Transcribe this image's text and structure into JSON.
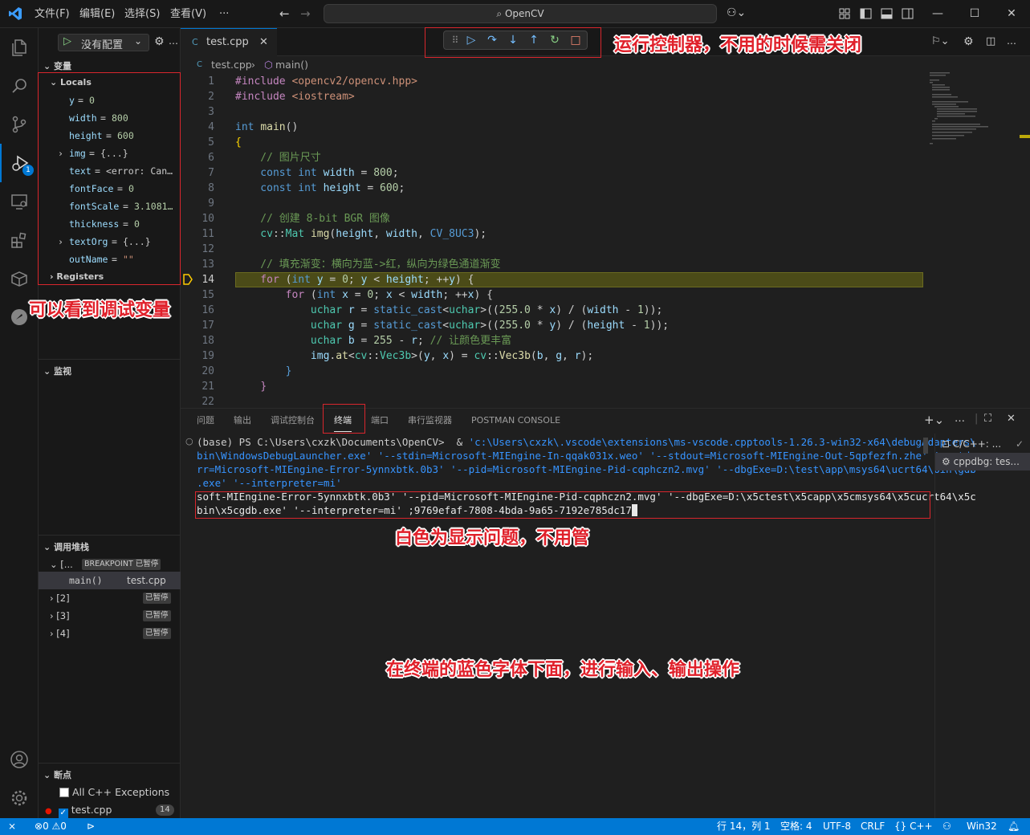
{
  "titlebar": {
    "menu": [
      "文件(F)",
      "编辑(E)",
      "选择(S)",
      "查看(V)",
      "···"
    ],
    "command_center": "OpenCV"
  },
  "sidebar": {
    "debug_config": "没有配置",
    "variables_header": "变量",
    "locals_header": "Locals",
    "locals": [
      {
        "name": "y",
        "value": "0",
        "kind": "num"
      },
      {
        "name": "width",
        "value": "800",
        "kind": "num"
      },
      {
        "name": "height",
        "value": "600",
        "kind": "num"
      },
      {
        "name": "img",
        "value": "{...}",
        "kind": "obj",
        "expandable": true
      },
      {
        "name": "text",
        "value": "<error: Can…",
        "kind": "obj"
      },
      {
        "name": "fontFace",
        "value": "0",
        "kind": "num"
      },
      {
        "name": "fontScale",
        "value": "3.1081…",
        "kind": "num"
      },
      {
        "name": "thickness",
        "value": "0",
        "kind": "num"
      },
      {
        "name": "textOrg",
        "value": "{...}",
        "kind": "obj",
        "expandable": true
      },
      {
        "name": "outName",
        "value": "\"\"",
        "kind": "str"
      }
    ],
    "registers_header": "Registers",
    "watch_header": "监视",
    "callstack_header": "调用堆栈",
    "callstack": {
      "thread_label": "[...",
      "thread_badge": "BREAKPOINT 已暂停",
      "frame_fn": "main()",
      "frame_file": "test.cpp",
      "threads": [
        {
          "label": "[2]",
          "badge": "已暂停"
        },
        {
          "label": "[3]",
          "badge": "已暂停"
        },
        {
          "label": "[4]",
          "badge": "已暂停"
        }
      ]
    },
    "breakpoints_header": "断点",
    "breakpoints": [
      {
        "label": "All C++ Exceptions",
        "checked": false
      },
      {
        "label": "test.cpp",
        "checked": true,
        "count": "14"
      }
    ]
  },
  "editor": {
    "tab": "test.cpp",
    "breadcrumb": [
      "test.cpp",
      "main()"
    ],
    "current_line": "14",
    "lines": [
      {
        "n": "1",
        "tokens": [
          [
            "pp",
            "#include "
          ],
          [
            "s",
            "<opencv2/opencv.hpp>"
          ]
        ]
      },
      {
        "n": "2",
        "tokens": [
          [
            "pp",
            "#include "
          ],
          [
            "s",
            "<iostream>"
          ]
        ]
      },
      {
        "n": "3",
        "tokens": []
      },
      {
        "n": "4",
        "tokens": [
          [
            "k",
            "int "
          ],
          [
            "f",
            "main"
          ],
          [
            "p",
            "()"
          ]
        ]
      },
      {
        "n": "5",
        "tokens": [
          [
            "br",
            "{"
          ]
        ]
      },
      {
        "n": "6",
        "tokens": [
          [
            "c",
            "    // 图片尺寸"
          ]
        ]
      },
      {
        "n": "7",
        "tokens": [
          [
            "k",
            "    const int "
          ],
          [
            "v",
            "width"
          ],
          [
            "p",
            " = "
          ],
          [
            "n",
            "800"
          ],
          [
            "p",
            ";"
          ]
        ]
      },
      {
        "n": "8",
        "tokens": [
          [
            "k",
            "    const int "
          ],
          [
            "v",
            "height"
          ],
          [
            "p",
            " = "
          ],
          [
            "n",
            "600"
          ],
          [
            "p",
            ";"
          ]
        ]
      },
      {
        "n": "9",
        "tokens": []
      },
      {
        "n": "10",
        "tokens": [
          [
            "c",
            "    // 创建 8-bit BGR 图像"
          ]
        ]
      },
      {
        "n": "11",
        "tokens": [
          [
            "t",
            "    cv"
          ],
          [
            "p",
            "::"
          ],
          [
            "t",
            "Mat "
          ],
          [
            "f",
            "img"
          ],
          [
            "p",
            "("
          ],
          [
            "v",
            "height"
          ],
          [
            "p",
            ", "
          ],
          [
            "v",
            "width"
          ],
          [
            "p",
            ", "
          ],
          [
            "k",
            "CV_8UC3"
          ],
          [
            "p",
            ");"
          ]
        ]
      },
      {
        "n": "12",
        "tokens": []
      },
      {
        "n": "13",
        "tokens": [
          [
            "c",
            "    // 填充渐变：横向为蓝->红，纵向为绿色通道渐变"
          ]
        ]
      },
      {
        "n": "14",
        "tokens": [
          [
            "pp",
            "    for "
          ],
          [
            "p",
            "("
          ],
          [
            "k",
            "int "
          ],
          [
            "v",
            "y"
          ],
          [
            "p",
            " = "
          ],
          [
            "n",
            "0"
          ],
          [
            "p",
            "; "
          ],
          [
            "v",
            "y"
          ],
          [
            "p",
            " < "
          ],
          [
            "v",
            "height"
          ],
          [
            "p",
            "; ++"
          ],
          [
            "v",
            "y"
          ],
          [
            "p",
            ") {"
          ]
        ]
      },
      {
        "n": "15",
        "tokens": [
          [
            "pp",
            "        for "
          ],
          [
            "p",
            "("
          ],
          [
            "k",
            "int "
          ],
          [
            "v",
            "x"
          ],
          [
            "p",
            " = "
          ],
          [
            "n",
            "0"
          ],
          [
            "p",
            "; "
          ],
          [
            "v",
            "x"
          ],
          [
            "p",
            " < "
          ],
          [
            "v",
            "width"
          ],
          [
            "p",
            "; ++"
          ],
          [
            "v",
            "x"
          ],
          [
            "p",
            ") {"
          ]
        ]
      },
      {
        "n": "16",
        "tokens": [
          [
            "t",
            "            uchar "
          ],
          [
            "v",
            "r"
          ],
          [
            "p",
            " = "
          ],
          [
            "k",
            "static_cast"
          ],
          [
            "p",
            "<"
          ],
          [
            "t",
            "uchar"
          ],
          [
            "p",
            ">(("
          ],
          [
            "n",
            "255.0"
          ],
          [
            "p",
            " * "
          ],
          [
            "v",
            "x"
          ],
          [
            "p",
            ") / ("
          ],
          [
            "v",
            "width"
          ],
          [
            "p",
            " - "
          ],
          [
            "n",
            "1"
          ],
          [
            "p",
            "));"
          ]
        ]
      },
      {
        "n": "17",
        "tokens": [
          [
            "t",
            "            uchar "
          ],
          [
            "v",
            "g"
          ],
          [
            "p",
            " = "
          ],
          [
            "k",
            "static_cast"
          ],
          [
            "p",
            "<"
          ],
          [
            "t",
            "uchar"
          ],
          [
            "p",
            ">(("
          ],
          [
            "n",
            "255.0"
          ],
          [
            "p",
            " * "
          ],
          [
            "v",
            "y"
          ],
          [
            "p",
            ") / ("
          ],
          [
            "v",
            "height"
          ],
          [
            "p",
            " - "
          ],
          [
            "n",
            "1"
          ],
          [
            "p",
            "));"
          ]
        ]
      },
      {
        "n": "18",
        "tokens": [
          [
            "t",
            "            uchar "
          ],
          [
            "v",
            "b"
          ],
          [
            "p",
            " = "
          ],
          [
            "n",
            "255"
          ],
          [
            "p",
            " - "
          ],
          [
            "v",
            "r"
          ],
          [
            "p",
            "; "
          ],
          [
            "c",
            "// 让颜色更丰富"
          ]
        ]
      },
      {
        "n": "19",
        "tokens": [
          [
            "v",
            "            img"
          ],
          [
            "p",
            "."
          ],
          [
            "f",
            "at"
          ],
          [
            "p",
            "<"
          ],
          [
            "t",
            "cv"
          ],
          [
            "p",
            "::"
          ],
          [
            "t",
            "Vec3b"
          ],
          [
            "p",
            ">("
          ],
          [
            "v",
            "y"
          ],
          [
            "p",
            ", "
          ],
          [
            "v",
            "x"
          ],
          [
            "p",
            ") = "
          ],
          [
            "t",
            "cv"
          ],
          [
            "p",
            "::"
          ],
          [
            "f",
            "Vec3b"
          ],
          [
            "p",
            "("
          ],
          [
            "v",
            "b"
          ],
          [
            "p",
            ", "
          ],
          [
            "v",
            "g"
          ],
          [
            "p",
            ", "
          ],
          [
            "v",
            "r"
          ],
          [
            "p",
            ");"
          ]
        ]
      },
      {
        "n": "20",
        "tokens": [
          [
            "p",
            "        "
          ],
          [
            "k",
            "}"
          ]
        ]
      },
      {
        "n": "21",
        "tokens": [
          [
            "p",
            "    "
          ],
          [
            "pp",
            "}"
          ]
        ]
      },
      {
        "n": "22",
        "tokens": []
      }
    ]
  },
  "annotations": {
    "debug_toolbar": "运行控制器，不用的时候需关闭",
    "variables": "可以看到调试变量",
    "terminal_white": "白色为显示问题，不用管",
    "terminal_io": "在终端的蓝色字体下面，进行输入、输出操作"
  },
  "panel": {
    "tabs": [
      "问题",
      "输出",
      "调试控制台",
      "终端",
      "端口",
      "串行监视器",
      "POSTMAN CONSOLE"
    ],
    "active_tab": "终端",
    "terminal_prompt": "(base) PS C:\\Users\\cxzk\\Documents\\OpenCV>  & ",
    "terminal_blue_1": "'c:\\Users\\cxzk\\.vscode\\extensions\\ms-vscode.cpptools-1.26.3-win32-x64\\debugAdapters\\",
    "terminal_blue_2": "bin\\WindowsDebugLauncher.exe' '--stdin=Microsoft-MIEngine-In-qqak031x.weo' '--stdout=Microsoft-MIEngine-Out-5qpfezfn.zhe' '--stde",
    "terminal_blue_3": "rr=Microsoft-MIEngine-Error-5ynnxbtk.0b3' '--pid=Microsoft-MIEngine-Pid-cqphczn2.mvg' '--dbgExe=D:\\test\\app\\msys64\\ucrt64\\bin\\gdb",
    "terminal_blue_4": ".exe' '--interpreter=mi'",
    "terminal_white_1": "soft-MIEngine-Error-5ynnxbtk.0b3' '--pid=Microsoft-MIEngine-Pid-cqphczn2.mvg' '--dbgExe=D:\\x5ctest\\x5capp\\x5cmsys64\\x5cucrt64\\x5c",
    "terminal_white_2": "bin\\x5cgdb.exe' '--interpreter=mi' ;9769efaf-7808-4bda-9a65-7192e785dc17",
    "term_list": [
      {
        "label": "C/C++: ...",
        "icon": "terminal-icon"
      },
      {
        "label": "cppdbg: tes...",
        "icon": "debug-icon"
      }
    ]
  },
  "status": {
    "errors": "0",
    "warnings": "0",
    "position": "行 14，列 1",
    "spaces": "空格: 4",
    "encoding": "UTF-8",
    "eol": "CRLF",
    "language": "C++",
    "platform": "Win32",
    "debug_badge": "1"
  },
  "colors": {
    "accent": "#0078d4",
    "annotation_red": "#e0202a",
    "current_line_bg": "#4b4b18"
  }
}
